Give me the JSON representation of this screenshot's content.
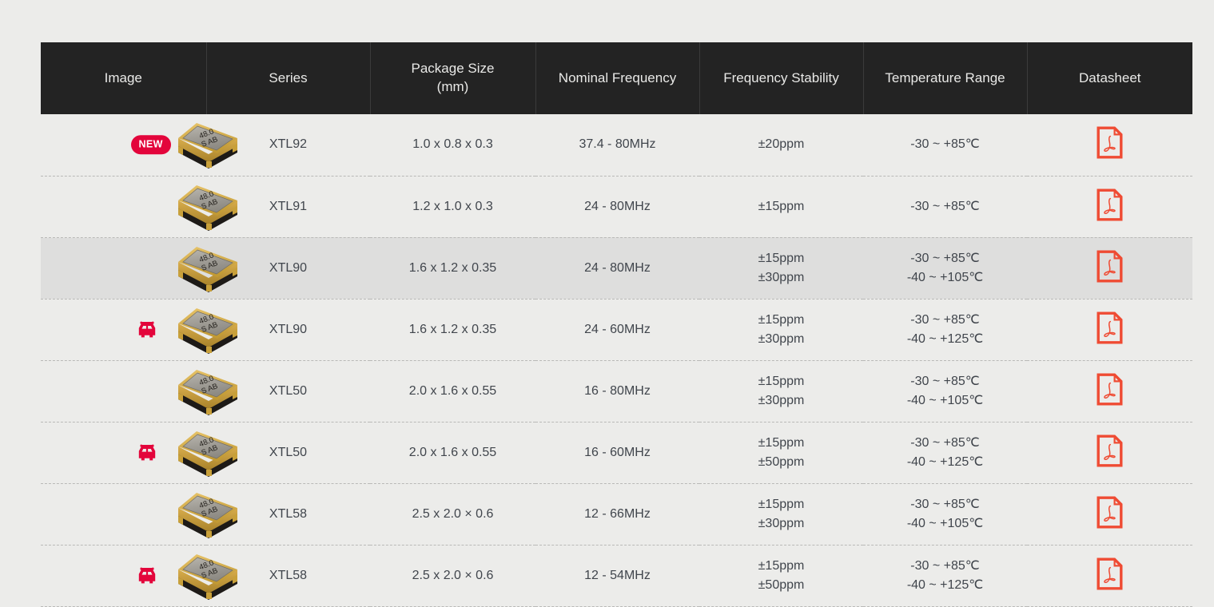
{
  "table": {
    "columns": [
      {
        "key": "image",
        "label": "Image"
      },
      {
        "key": "series",
        "label": "Series"
      },
      {
        "key": "size",
        "label": "Package Size\n(mm)",
        "label_line1": "Package Size",
        "label_line2": "(mm)"
      },
      {
        "key": "frequency",
        "label": "Nominal Frequency"
      },
      {
        "key": "stability",
        "label": "Frequency Stability"
      },
      {
        "key": "temp",
        "label": "Temperature Range"
      },
      {
        "key": "datasheet",
        "label": "Datasheet"
      }
    ],
    "rows": [
      {
        "badge": "NEW",
        "badge_type": "new",
        "image_icon": "crystal-package-image",
        "image_marking_line1": "48.0",
        "image_marking_line2": "S AB",
        "series": "XTL92",
        "size": "1.0 x 0.8 x 0.3",
        "frequency": "37.4 - 80MHz",
        "stability": [
          "±20ppm"
        ],
        "temp": [
          "-30 ~ +85℃"
        ],
        "datasheet_icon": "pdf-icon",
        "highlight": false
      },
      {
        "badge": null,
        "badge_type": null,
        "image_icon": "crystal-package-image",
        "image_marking_line1": "48.0",
        "image_marking_line2": "S AB",
        "series": "XTL91",
        "size": "1.2 x 1.0 x 0.3",
        "frequency": "24 - 80MHz",
        "stability": [
          "±15ppm"
        ],
        "temp": [
          "-30 ~ +85℃"
        ],
        "datasheet_icon": "pdf-icon",
        "highlight": false
      },
      {
        "badge": null,
        "badge_type": null,
        "image_icon": "crystal-package-image",
        "image_marking_line1": "48.0",
        "image_marking_line2": "S AB",
        "series": "XTL90",
        "size": "1.6 x 1.2 x 0.35",
        "frequency": "24 - 80MHz",
        "stability": [
          "±15ppm",
          "±30ppm"
        ],
        "temp": [
          "-30 ~ +85℃",
          "-40 ~ +105℃"
        ],
        "datasheet_icon": "pdf-icon",
        "highlight": true
      },
      {
        "badge": "car",
        "badge_type": "automotive",
        "image_icon": "crystal-package-image",
        "image_marking_line1": "48.0",
        "image_marking_line2": "S AB",
        "series": "XTL90",
        "size": "1.6 x 1.2 x 0.35",
        "frequency": "24 - 60MHz",
        "stability": [
          "±15ppm",
          "±30ppm"
        ],
        "temp": [
          "-30 ~ +85℃",
          "-40 ~ +125℃"
        ],
        "datasheet_icon": "pdf-icon",
        "highlight": false
      },
      {
        "badge": null,
        "badge_type": null,
        "image_icon": "crystal-package-image",
        "image_marking_line1": "48.0",
        "image_marking_line2": "S AB",
        "series": "XTL50",
        "size": "2.0 x 1.6 x 0.55",
        "frequency": "16 - 80MHz",
        "stability": [
          "±15ppm",
          "±30ppm"
        ],
        "temp": [
          "-30 ~ +85℃",
          "-40 ~ +105℃"
        ],
        "datasheet_icon": "pdf-icon",
        "highlight": false
      },
      {
        "badge": "car",
        "badge_type": "automotive",
        "image_icon": "crystal-package-image",
        "image_marking_line1": "48.0",
        "image_marking_line2": "S AB",
        "series": "XTL50",
        "size": "2.0 x 1.6 x 0.55",
        "frequency": "16 - 60MHz",
        "stability": [
          "±15ppm",
          "±50ppm"
        ],
        "temp": [
          "-30 ~ +85℃",
          "-40 ~ +125℃"
        ],
        "datasheet_icon": "pdf-icon",
        "highlight": false
      },
      {
        "badge": null,
        "badge_type": null,
        "image_icon": "crystal-package-image",
        "image_marking_line1": "48.0",
        "image_marking_line2": "S AB",
        "series": "XTL58",
        "size": "2.5 x 2.0 × 0.6",
        "frequency": "12 - 66MHz",
        "stability": [
          "±15ppm",
          "±30ppm"
        ],
        "temp": [
          "-30 ~ +85℃",
          "-40 ~ +105℃"
        ],
        "datasheet_icon": "pdf-icon",
        "highlight": false
      },
      {
        "badge": "car",
        "badge_type": "automotive",
        "image_icon": "crystal-package-image",
        "image_marking_line1": "48.0",
        "image_marking_line2": "S AB",
        "series": "XTL58",
        "size": "2.5 x 2.0 × 0.6",
        "frequency": "12 - 54MHz",
        "stability": [
          "±15ppm",
          "±50ppm"
        ],
        "temp": [
          "-30 ~ +85℃",
          "-40 ~ +125℃"
        ],
        "datasheet_icon": "pdf-icon",
        "highlight": false
      }
    ]
  },
  "colors": {
    "header_background": "#232323",
    "header_text": "#e9e9e7",
    "page_background": "#ececea",
    "row_background": "#ececea",
    "row_highlight_background": "#dededd",
    "row_divider": "#b9b9b7",
    "body_text": "#40454c",
    "badge_new": "#e3053b",
    "badge_car": "#e3053b",
    "pdf_icon": "#ef4b33"
  }
}
